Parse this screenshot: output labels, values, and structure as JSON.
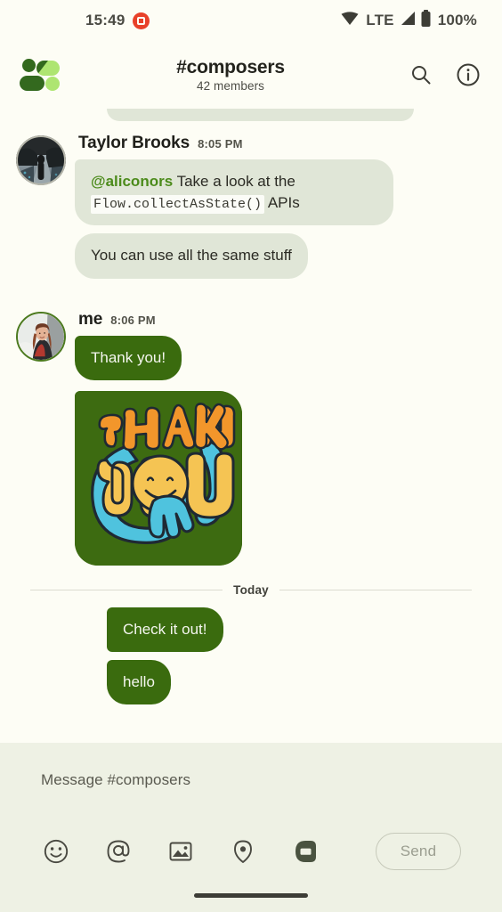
{
  "status_bar": {
    "time": "15:49",
    "record_icon": "screen-record-icon",
    "wifi_icon": "wifi-icon",
    "network_label": "LTE",
    "signal_icon": "signal-icon",
    "battery_icon": "battery-icon",
    "battery_percent": "100%"
  },
  "app_bar": {
    "logo_icon": "app-logo-icon",
    "title": "#composers",
    "subtitle": "42 members",
    "search_icon": "search-icon",
    "info_icon": "info-icon"
  },
  "conversation": {
    "groups": [
      {
        "sender": "Taylor Brooks",
        "timestamp": "8:05 PM",
        "side": "in",
        "avatar_alt": "taylor-brooks-avatar",
        "messages": [
          {
            "mention": "@aliconors",
            "text_before_code": " Take a look at the ",
            "code": "Flow.collectAsState()",
            "text_after_code": " APIs"
          },
          {
            "text": "You can use all the same stuff"
          }
        ]
      },
      {
        "sender": "me",
        "timestamp": "8:06 PM",
        "side": "out",
        "avatar_alt": "me-avatar",
        "messages": [
          {
            "text": "Thank you!"
          },
          {
            "sticker": "thank-you-sticker",
            "sticker_text_top": "THANK",
            "sticker_text_bottom": "YOU"
          }
        ]
      }
    ],
    "day_divider": "Today",
    "today_messages": [
      {
        "text": "Check it out!"
      },
      {
        "text": "hello"
      }
    ]
  },
  "composer": {
    "placeholder": "Message #composers",
    "tools": [
      {
        "name": "emoji-icon",
        "label": "Emoji"
      },
      {
        "name": "mention-icon",
        "label": "Mention"
      },
      {
        "name": "image-icon",
        "label": "Image"
      },
      {
        "name": "location-icon",
        "label": "Location"
      },
      {
        "name": "video-call-icon",
        "label": "Video call"
      }
    ],
    "send_label": "Send"
  },
  "colors": {
    "background": "#FDFDF5",
    "incoming_bubble": "#E0E6D7",
    "outgoing_bubble": "#3A6B0E",
    "mention": "#4C8B1B",
    "composer_bg": "#EEF1E4",
    "logo_dark": "#33691E",
    "logo_light": "#AEE571",
    "record_red": "#E8412A",
    "sticker_bg": "#3D6B11",
    "sticker_orange": "#F2962B",
    "sticker_yellow": "#F5C453",
    "sticker_blue": "#4FC3DE"
  }
}
